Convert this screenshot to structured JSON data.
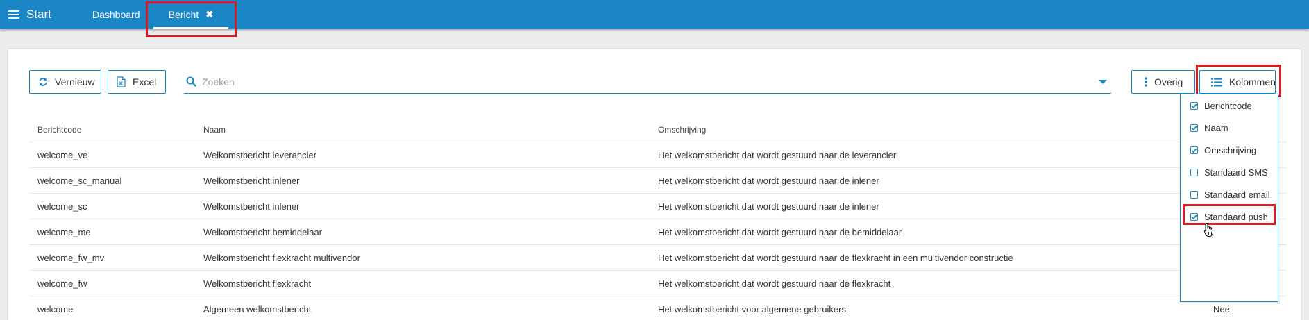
{
  "nav": {
    "start_label": "Start",
    "tabs": [
      {
        "label": "Dashboard"
      },
      {
        "label": "Bericht",
        "close_glyph": "✖"
      }
    ]
  },
  "toolbar": {
    "vernieuw_label": "Vernieuw",
    "excel_label": "Excel",
    "search_placeholder": "Zoeken",
    "overig_label": "Overig",
    "kolommen_label": "Kolommen"
  },
  "table": {
    "headers": [
      "Berichtcode",
      "Naam",
      "Omschrijving",
      ""
    ],
    "rows": [
      [
        "welcome_ve",
        "Welkomstbericht leverancier",
        "Het welkomstbericht dat wordt gestuurd naar de leverancier",
        ""
      ],
      [
        "welcome_sc_manual",
        "Welkomstbericht inlener",
        "Het welkomstbericht dat wordt gestuurd naar de inlener",
        ""
      ],
      [
        "welcome_sc",
        "Welkomstbericht inlener",
        "Het welkomstbericht dat wordt gestuurd naar de inlener",
        ""
      ],
      [
        "welcome_me",
        "Welkomstbericht bemiddelaar",
        "Het welkomstbericht dat wordt gestuurd naar de bemiddelaar",
        ""
      ],
      [
        "welcome_fw_mv",
        "Welkomstbericht flexkracht multivendor",
        "Het welkomstbericht dat wordt gestuurd naar de flexkracht in een multivendor constructie",
        ""
      ],
      [
        "welcome_fw",
        "Welkomstbericht flexkracht",
        "Het welkomstbericht dat wordt gestuurd naar de flexkracht",
        ""
      ],
      [
        "welcome",
        "Algemeen welkomstbericht",
        "Het welkomstbericht voor algemene gebruikers",
        "Nee"
      ]
    ]
  },
  "columns_menu": [
    {
      "label": "Berichtcode",
      "checked": true
    },
    {
      "label": "Naam",
      "checked": true
    },
    {
      "label": "Omschrijving",
      "checked": true
    },
    {
      "label": "Standaard SMS",
      "checked": false
    },
    {
      "label": "Standaard email",
      "checked": false
    },
    {
      "label": "Standaard push",
      "checked": true
    }
  ],
  "colors": {
    "primary": "#1a86c6",
    "highlight": "#d91c25",
    "background": "#ececec"
  }
}
